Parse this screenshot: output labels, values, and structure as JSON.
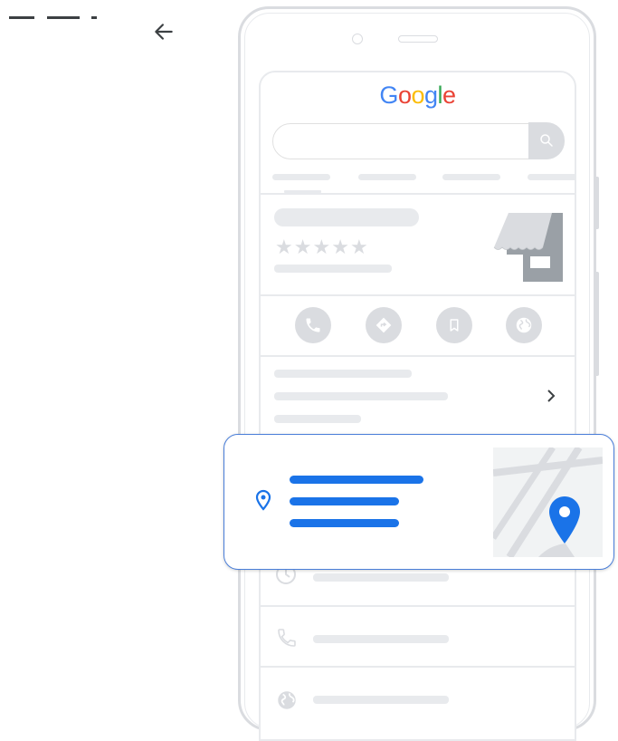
{
  "header": {
    "logo_text": "Google",
    "logo_colors": [
      "#4285F4",
      "#EA4335",
      "#FBBC05",
      "#4285F4",
      "#34A853",
      "#EA4335"
    ],
    "icons": [
      "menu-dashes-icon",
      "back-arrow-icon"
    ]
  },
  "search": {
    "placeholder": ""
  },
  "listing": {
    "rating_stars": 5,
    "icons": [
      "storefront-icon",
      "star-icon",
      "chevron-right-icon"
    ],
    "actions": [
      {
        "name": "call",
        "icon": "phone-icon"
      },
      {
        "name": "directions",
        "icon": "directions-icon"
      },
      {
        "name": "save",
        "icon": "bookmark-icon"
      },
      {
        "name": "website",
        "icon": "globe-icon"
      }
    ],
    "info_rows": [
      {
        "icon": "clock-icon"
      },
      {
        "icon": "phone-icon"
      },
      {
        "icon": "globe-icon"
      }
    ]
  },
  "address_card": {
    "icons": [
      "location-pin-icon",
      "map-thumbnail",
      "map-pin-icon"
    ],
    "accent_color": "#1a73e8"
  },
  "colors": {
    "placeholder_gray": "#e8eaed",
    "icon_gray": "#dadce0",
    "border_blue": "#4a7ed9"
  }
}
